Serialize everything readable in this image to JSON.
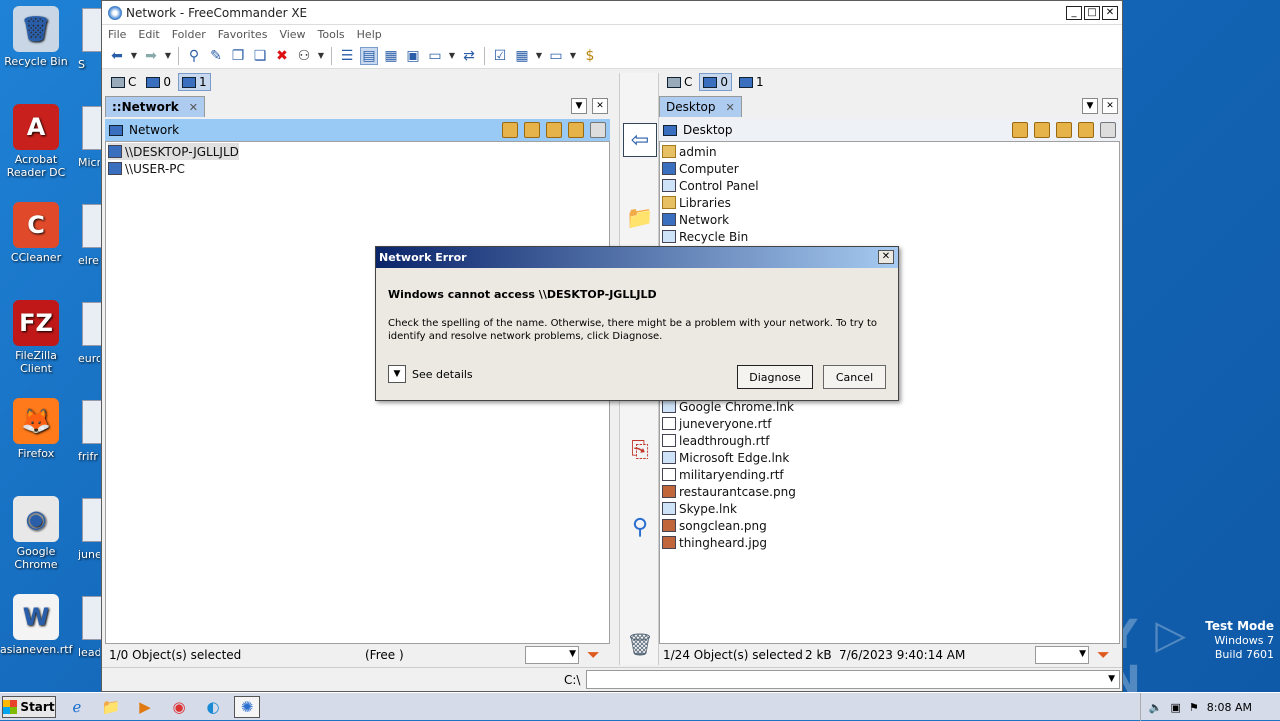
{
  "desktop": {
    "icons": [
      {
        "label": "Recycle Bin",
        "glyph": "🗑",
        "color": "#c8d6e5"
      },
      {
        "label": "Acrobat Reader DC",
        "glyph": "A",
        "color": "#c8201c"
      },
      {
        "label": "CCleaner",
        "glyph": "C",
        "color": "#e04a2a"
      },
      {
        "label": "FileZilla Client",
        "glyph": "FZ",
        "color": "#c01818"
      },
      {
        "label": "Firefox",
        "glyph": "🦊",
        "color": "#ff7a1a"
      },
      {
        "label": "Google Chrome",
        "glyph": "◉",
        "color": "#e8e8e8"
      },
      {
        "label": "asianeven.rtf",
        "glyph": "W",
        "color": "#f4f4f4"
      }
    ],
    "partial_labels": [
      "S",
      "Micro",
      "elre",
      "euro",
      "frifr",
      "june",
      "leadt"
    ],
    "watermark": "ANY ▷ RUN",
    "test_mode": {
      "line1": "Test Mode",
      "line2": "Windows 7",
      "line3": "Build 7601"
    }
  },
  "window": {
    "title": "Network - FreeCommander XE",
    "menu": [
      "File",
      "Edit",
      "Folder",
      "Favorites",
      "View",
      "Tools",
      "Help"
    ],
    "controls": [
      "_",
      "□",
      "✕"
    ]
  },
  "left_panel": {
    "drives": [
      "C",
      "0",
      "1"
    ],
    "tab_label": "::Network",
    "path": "Network",
    "items": [
      "\\\\DESKTOP-JGLLJLD",
      "\\\\USER-PC"
    ],
    "status": "1/0 Object(s) selected",
    "free": "(Free )"
  },
  "right_panel": {
    "drives": [
      "C",
      "0",
      "1"
    ],
    "tab_label": "Desktop",
    "path": "Desktop",
    "items_top": [
      {
        "name": "admin",
        "type": "fold"
      },
      {
        "name": "Computer",
        "type": "pc"
      },
      {
        "name": "Control Panel",
        "type": "lnk"
      },
      {
        "name": "Libraries",
        "type": "fold"
      },
      {
        "name": "Network",
        "type": "pc"
      },
      {
        "name": "Recycle Bin",
        "type": "lnk"
      }
    ],
    "items_bottom": [
      {
        "name": "Google Chrome.lnk",
        "type": "lnk"
      },
      {
        "name": "juneveryone.rtf",
        "type": "doc"
      },
      {
        "name": "leadthrough.rtf",
        "type": "doc"
      },
      {
        "name": "Microsoft Edge.lnk",
        "type": "lnk"
      },
      {
        "name": "militaryending.rtf",
        "type": "doc"
      },
      {
        "name": "restaurantcase.png",
        "type": "img"
      },
      {
        "name": "Skype.lnk",
        "type": "lnk"
      },
      {
        "name": "songclean.png",
        "type": "img"
      },
      {
        "name": "thingheard.jpg",
        "type": "img"
      }
    ],
    "status": "1/24 Object(s) selected",
    "size": "2 kB",
    "date": "7/6/2023 9:40:14 AM"
  },
  "cmdline": {
    "label": "C:\\",
    "value": ""
  },
  "dialog": {
    "title": "Network Error",
    "heading": "Windows cannot access \\\\DESKTOP-JGLLJLD",
    "body": "Check the spelling of the name. Otherwise, there might be a problem with your network. To try to identify and resolve network problems, click Diagnose.",
    "details_label": "See details",
    "diagnose_label": "Diagnose",
    "cancel_label": "Cancel"
  },
  "taskbar": {
    "start_label": "Start",
    "clock": "8:08 AM"
  }
}
